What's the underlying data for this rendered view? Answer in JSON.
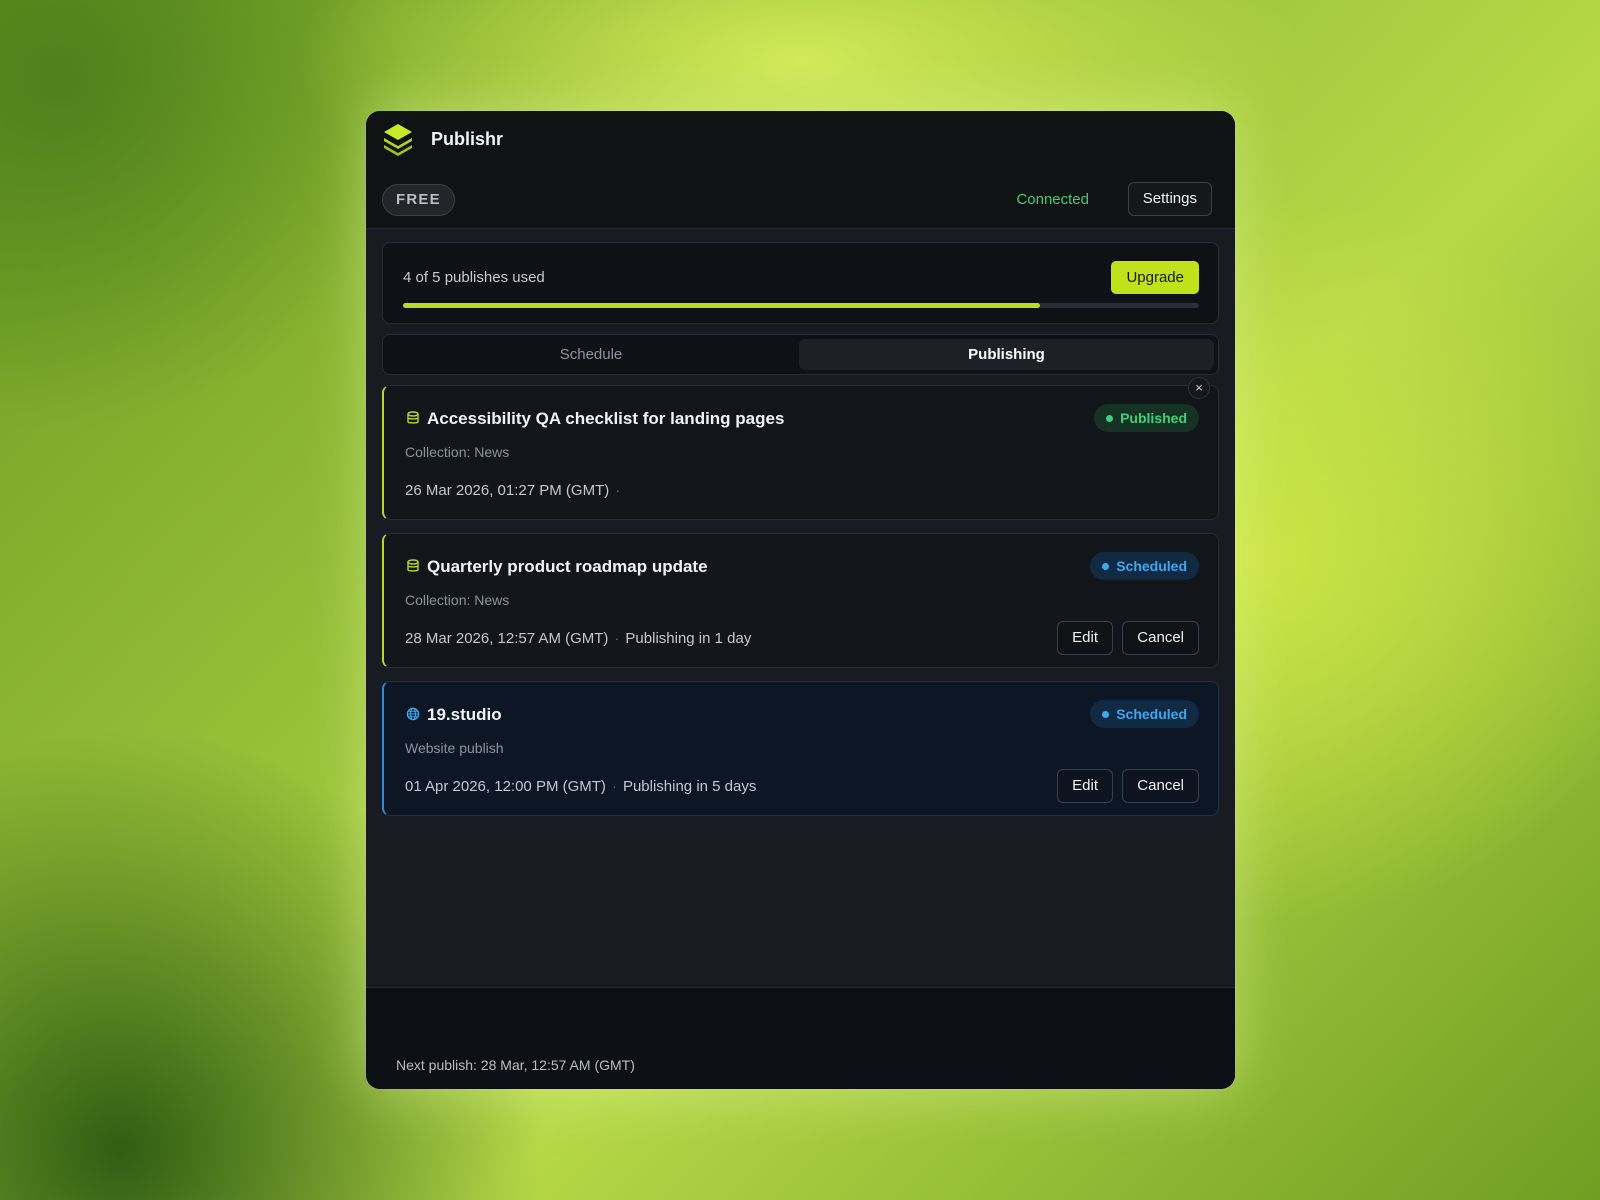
{
  "app": {
    "title": "Publishr",
    "plan": "FREE",
    "connection_status": "Connected",
    "settings_label": "Settings"
  },
  "usage": {
    "text": "4 of 5 publishes used",
    "used": 4,
    "limit": 5,
    "upgrade_label": "Upgrade"
  },
  "tabs": [
    {
      "label": "Schedule",
      "active": false
    },
    {
      "label": "Publishing",
      "active": true
    }
  ],
  "close_label": "×",
  "items": [
    {
      "icon": "database-icon",
      "title": "Accessibility QA checklist for landing pages",
      "subtitle": "Collection:  News",
      "datetime": "26 Mar 2026, 01:27 PM (GMT)",
      "separator": "·",
      "eta": "",
      "status": "Published",
      "edit_label": "",
      "cancel_label": ""
    },
    {
      "icon": "database-icon",
      "title": "Quarterly product roadmap update",
      "subtitle": "Collection:  News",
      "datetime": "28 Mar 2026, 12:57 AM (GMT)",
      "separator": "·",
      "eta": "Publishing in 1 day",
      "status": "Scheduled",
      "edit_label": "Edit",
      "cancel_label": "Cancel"
    },
    {
      "icon": "globe-icon",
      "title": "19.studio",
      "subtitle": "Website publish",
      "datetime": "01 Apr 2026, 12:00 PM (GMT)",
      "separator": "·",
      "eta": "Publishing in 5 days",
      "status": "Scheduled",
      "edit_label": "Edit",
      "cancel_label": "Cancel"
    }
  ],
  "footer": {
    "text": "Next publish: 28 Mar, 12:57 AM (GMT)"
  },
  "colors": {
    "accent": "#c1e21a",
    "connected": "#3ccf7a",
    "published": "#40cf7b",
    "scheduled": "#3ea8ef"
  }
}
